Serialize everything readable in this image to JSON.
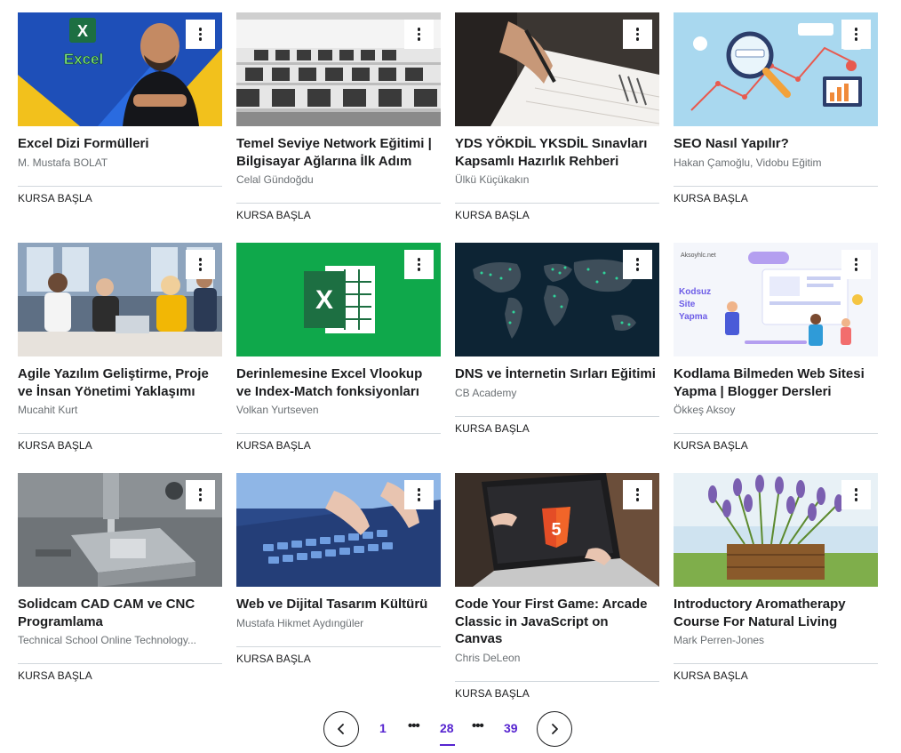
{
  "courses": [
    {
      "title": "Excel Dizi Formülleri",
      "instructor": "M. Mustafa BOLAT",
      "cta": "KURSA BAŞLA",
      "thumb_icon": "excel-instructor-image",
      "thumb_text": "Excel"
    },
    {
      "title": "Temel Seviye Network Eğitimi | Bilgisayar Ağlarına İlk Adım",
      "instructor": "Celal Gündoğdu",
      "cta": "KURSA BAŞLA",
      "thumb_icon": "computer-lab-image"
    },
    {
      "title": "YDS YÖKDİL YKSDİL Sınavları Kapsamlı Hazırlık Rehberi",
      "instructor": "Ülkü Küçükakın",
      "cta": "KURSA BAŞLA",
      "thumb_icon": "writing-hand-image"
    },
    {
      "title": "SEO Nasıl Yapılır?",
      "instructor": "Hakan Çamoğlu, Vidobu Eğitim",
      "cta": "KURSA BAŞLA",
      "thumb_icon": "seo-magnifier-image"
    },
    {
      "title": "Agile Yazılım Geliştirme, Proje ve İnsan Yönetimi Yaklaşımı",
      "instructor": "Mucahit Kurt",
      "cta": "KURSA BAŞLA",
      "thumb_icon": "office-team-image"
    },
    {
      "title": "Derinlemesine Excel Vlookup ve Index-Match fonksiyonları",
      "instructor": "Volkan Yurtseven",
      "cta": "KURSA BAŞLA",
      "thumb_icon": "excel-logo-image",
      "thumb_text": "X"
    },
    {
      "title": "DNS ve İnternetin Sırları Eğitimi",
      "instructor": "CB Academy",
      "cta": "KURSA BAŞLA",
      "thumb_icon": "world-map-image"
    },
    {
      "title": "Kodlama Bilmeden Web Sitesi Yapma | Blogger Dersleri",
      "instructor": "Ökkeş Aksoy",
      "cta": "KURSA BAŞLA",
      "thumb_icon": "web-builder-illustration",
      "thumb_text": "Kodsuz Site Yapma",
      "thumb_brand": "Aksoyhlc.net"
    },
    {
      "title": "Solidcam CAD CAM ve CNC Programlama",
      "instructor": "Technical School Online Technology...",
      "cta": "KURSA BAŞLA",
      "thumb_icon": "cnc-machine-image"
    },
    {
      "title": "Web ve Dijital Tasarım Kültürü",
      "instructor": "Mustafa Hikmet Aydıngüler",
      "cta": "KURSA BAŞLA",
      "thumb_icon": "keyboard-typing-image"
    },
    {
      "title": "Code Your First Game: Arcade Classic in JavaScript on Canvas",
      "instructor": "Chris DeLeon",
      "cta": "KURSA BAŞLA",
      "thumb_icon": "html5-laptop-image",
      "thumb_text": "5"
    },
    {
      "title": "Introductory Aromatherapy Course For Natural Living",
      "instructor": "Mark Perren-Jones",
      "cta": "KURSA BAŞLA",
      "thumb_icon": "lavender-crate-image"
    }
  ],
  "pagination": {
    "prev_icon": "chevron-left-icon",
    "next_icon": "chevron-right-icon",
    "first": "1",
    "ellipsis": "•••",
    "current": "28",
    "last": "39"
  },
  "colors": {
    "accent": "#5624d0",
    "text": "#1c1d1f",
    "muted": "#6a6f73",
    "divider": "#d1d7dc"
  }
}
